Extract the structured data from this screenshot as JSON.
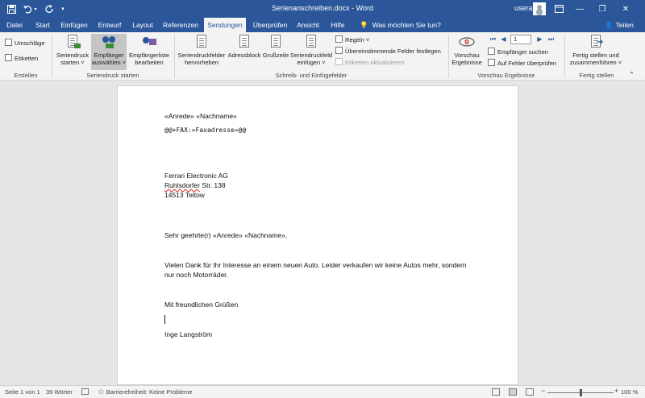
{
  "titlebar": {
    "title": "Serienanschreiben.docx  -  Word",
    "user": "usera",
    "controls": [
      "—",
      "❐",
      "✕"
    ]
  },
  "tabs": [
    {
      "label": "Datei"
    },
    {
      "label": "Start"
    },
    {
      "label": "Einfügen"
    },
    {
      "label": "Entwurf"
    },
    {
      "label": "Layout"
    },
    {
      "label": "Referenzen"
    },
    {
      "label": "Sendungen"
    },
    {
      "label": "Überprüfen"
    },
    {
      "label": "Ansicht"
    },
    {
      "label": "Hilfe"
    }
  ],
  "tell_me": "Was möchten Sie tun?",
  "share": "Teilen",
  "ribbon": {
    "create": {
      "label": "Erstellen",
      "envelopes": "Umschläge",
      "labels": "Etiketten"
    },
    "start_merge": {
      "label": "Seriendruck starten",
      "start": [
        "Seriendruck",
        "starten ˅"
      ],
      "select_recipients": [
        "Empfänger",
        "auswählen ˅"
      ],
      "edit_list": [
        "Empfängerliste",
        "bearbeiten"
      ]
    },
    "fields": {
      "label": "Schreib- und Einfügefelder",
      "highlight": [
        "Seriendruckfelder",
        "hervorheben"
      ],
      "address": "Adressblock",
      "greeting": "Grußzeile",
      "insert_field": [
        "Seriendruckfeld",
        "einfügen ˅"
      ],
      "rules": "Regeln ˅",
      "match_fields": "Übereinstimmende Felder festlegen",
      "update_labels": "Etiketten aktualisieren"
    },
    "preview": {
      "label": "Vorschau Ergebnisse",
      "preview": [
        "Vorschau",
        "Ergebnisse"
      ],
      "record": "1",
      "find_recipient": "Empfänger suchen",
      "check_errors": "Auf Fehler überprüfen"
    },
    "finish": {
      "label": "Fertig stellen",
      "finish_merge": [
        "Fertig stellen und",
        "zusammenführen ˅"
      ]
    }
  },
  "document": {
    "salutation_fields": "«Anrede» «Nachname»",
    "fax_field": "@@+FAX:«Faxadresse»@@",
    "company": "Ferrari Electronic AG",
    "street_word": "Ruhlsdorfer",
    "street_rest": " Str. 138",
    "city": "14513 Teltow",
    "greeting_line": "Sehr geehrte(r) «Anrede» «Nachname»,",
    "body_line1": "Vielen Dank für Ihr Interesse an einem neuen Auto. Leider verkaufen wir keine Autos mehr, sondern",
    "body_line2": "nur noch Motorräder.",
    "closing": "Mit freundlichen Grüßen",
    "signature": "Inge Langström"
  },
  "status": {
    "page": "Seite 1 von 1",
    "words": "39 Wörter",
    "accessibility": "Barrierefreiheit: Keine Probleme",
    "zoom": "100 %",
    "zoom_fraction": 0.5
  }
}
